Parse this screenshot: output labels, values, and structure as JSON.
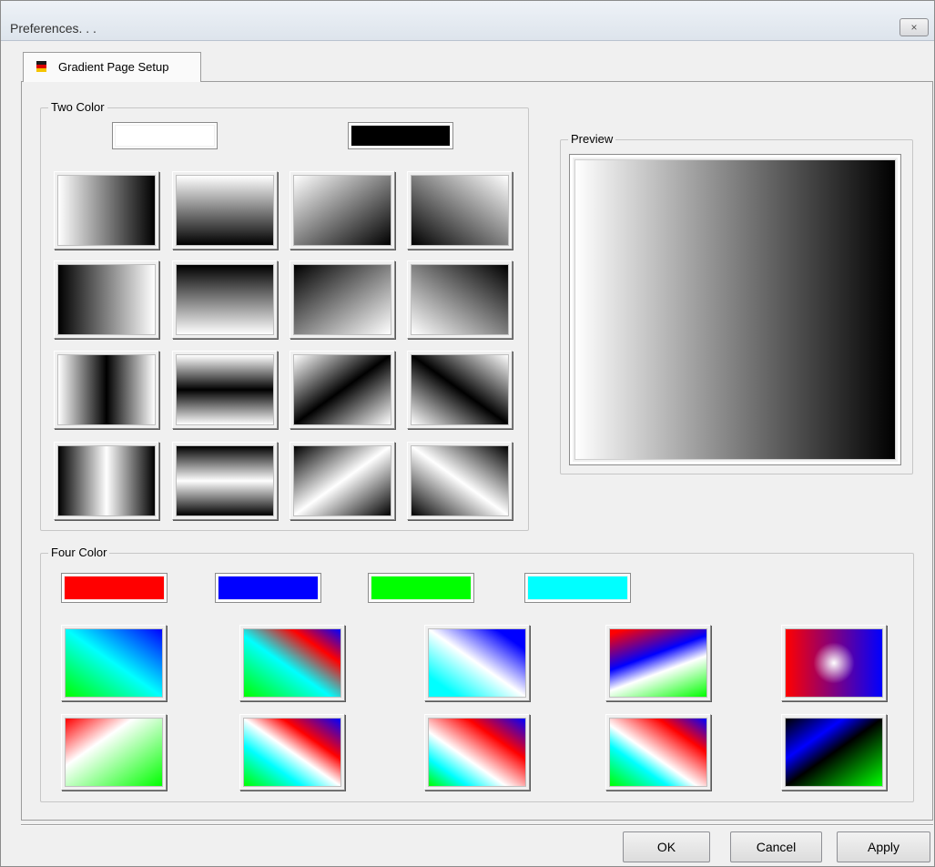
{
  "window": {
    "title": "Preferences. . .",
    "close_label": "×"
  },
  "tab": {
    "label": "Gradient Page Setup",
    "icon": "flag-icon"
  },
  "two_color": {
    "label": "Two Color",
    "color1": "#ffffff",
    "color2": "#000000",
    "styles": [
      "Horizontal",
      "Vertical",
      "Diagonal down",
      "Diagonal up",
      "Horizontal reversed",
      "Vertical reversed",
      "Diagonal down reversed",
      "Diagonal up reversed",
      "Horizontal center",
      "Vertical center",
      "Diagonal down center",
      "Diagonal up center",
      "Horizontal center reversed",
      "Vertical center reversed",
      "Diagonal down center reversed",
      "Diagonal up center reversed"
    ]
  },
  "preview": {
    "label": "Preview"
  },
  "four_color": {
    "label": "Four Color",
    "colors": [
      "#ff0000",
      "#0000ff",
      "#00ff00",
      "#00ffff"
    ],
    "styles": [
      "Style 1",
      "Style 2",
      "Style 3",
      "Style 4",
      "Style 5",
      "Style 6",
      "Style 7",
      "Style 8",
      "Style 9",
      "Style 10"
    ]
  },
  "buttons": {
    "ok": "OK",
    "cancel": "Cancel",
    "apply": "Apply"
  }
}
